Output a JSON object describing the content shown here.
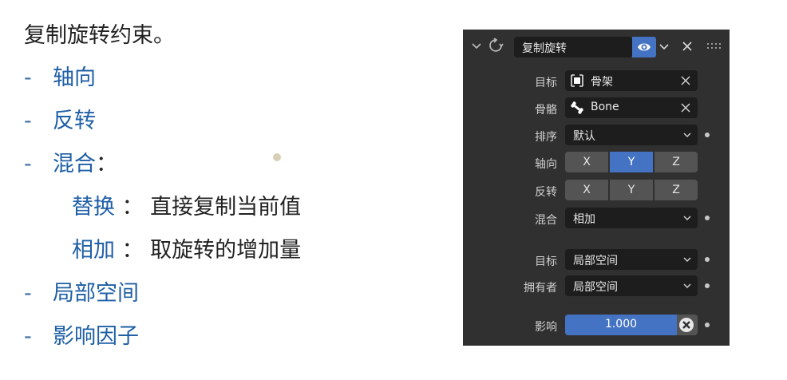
{
  "doc": {
    "title": "复制旋转约束。",
    "items": [
      {
        "dash": "-",
        "label": "轴向"
      },
      {
        "dash": "-",
        "label": "反转"
      },
      {
        "dash": "-",
        "label": "混合",
        "suffix": "："
      },
      {
        "dash": "-",
        "label": "局部空间"
      },
      {
        "dash": "-",
        "label": "影响因子"
      }
    ],
    "blend_modes": [
      {
        "term": "替换",
        "sep": " ： ",
        "desc": "直接复制当前值"
      },
      {
        "term": "相加",
        "sep": " ： ",
        "desc": "取旋转的增加量"
      }
    ]
  },
  "panel": {
    "name": "复制旋转",
    "target": {
      "label": "目标",
      "value": "骨架"
    },
    "bone": {
      "label": "骨骼",
      "value": "Bone"
    },
    "order": {
      "label": "排序",
      "value": "默认"
    },
    "axis": {
      "label": "轴向",
      "x": "X",
      "y": "Y",
      "z": "Z",
      "active": "Y"
    },
    "invert": {
      "label": "反转",
      "x": "X",
      "y": "Y",
      "z": "Z"
    },
    "mix": {
      "label": "混合",
      "value": "相加"
    },
    "target_space": {
      "label": "目标",
      "value": "局部空间"
    },
    "owner_space": {
      "label": "拥有者",
      "value": "局部空间"
    },
    "influence": {
      "label": "影响",
      "value": "1.000",
      "fraction": 1.0
    }
  },
  "colors": {
    "accent": "#4573c4",
    "panel_bg": "#303030",
    "field_bg": "#1d1d1d",
    "button_bg": "#545454",
    "term_blue": "#1f5fa6"
  },
  "icons": [
    "chevron-down-icon",
    "copy-rotation-constraint-icon",
    "eye-icon",
    "close-icon",
    "drag-handle-icon",
    "armature-icon",
    "bone-icon",
    "clear-icon"
  ]
}
